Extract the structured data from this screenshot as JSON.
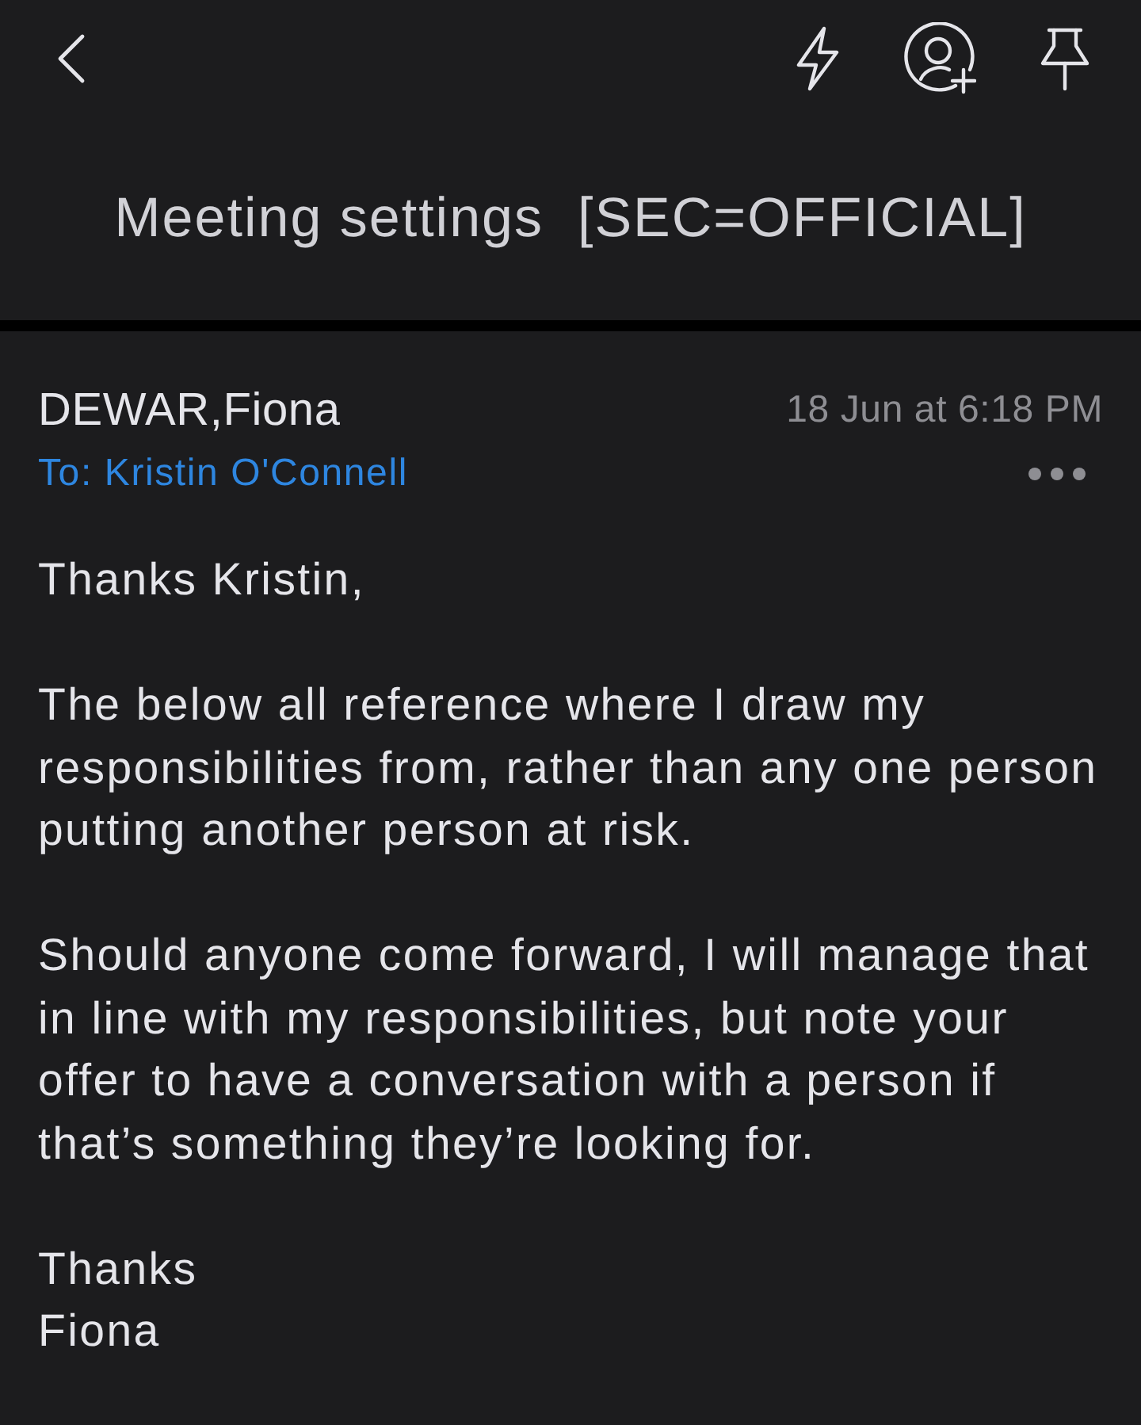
{
  "title": "Meeting settings  [SEC=OFFICIAL]",
  "message": {
    "sender": "DEWAR,Fiona",
    "time": "18 Jun at 6:18 PM",
    "to": "To: Kristin O'Connell",
    "body": [
      [
        "Thanks Kristin,"
      ],
      [
        "The below all reference where I draw my",
        "responsibilities from, rather than any one person",
        "putting another person at risk."
      ],
      [
        "Should anyone come forward, I will manage that",
        "in line with my responsibilities, but note your",
        "offer to have a conversation with a person if",
        "that’s something they’re looking for."
      ],
      [
        "Thanks",
        "Fiona"
      ]
    ]
  }
}
